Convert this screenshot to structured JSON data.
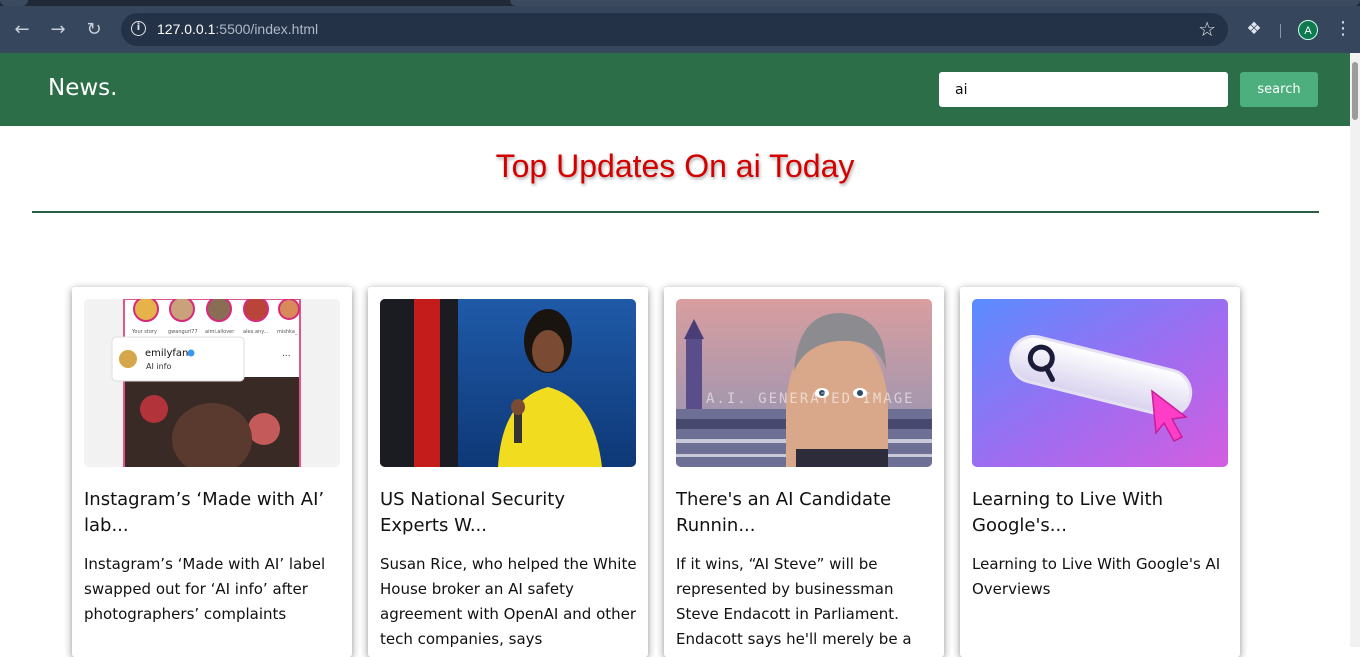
{
  "browser": {
    "url_host": "127.0.0.1",
    "url_rest": ":5500/index.html",
    "profile_initial": "A"
  },
  "header": {
    "brand": "News.",
    "search_value": "ai",
    "search_button": "search"
  },
  "page": {
    "heading": "Top Updates On ai Today"
  },
  "cards": [
    {
      "title": "Instagram’s ‘Made with AI’ lab...",
      "description": "Instagram’s ‘Made with AI’ label swapped out for ‘AI info’ after photographers’ complaints",
      "thumb_caption": "emilyfan",
      "thumb_sub": "AI info",
      "thumb_names": [
        "Your story",
        "gwangurl77",
        "aimi.allover",
        "alex.any...",
        "mishka_"
      ]
    },
    {
      "title": "US National Security Experts W...",
      "description": "Susan Rice, who helped the White House broker an AI safety agreement with OpenAI and other tech companies, says"
    },
    {
      "title": "There's an AI Candidate Runnin...",
      "description": "If it wins, “AI Steve” will be represented by businessman Steve Endacott in Parliament. Endacott says he'll merely be a",
      "thumb_watermark": "A.I. GENERATED IMAGE"
    },
    {
      "title": "Learning to Live With Google's...",
      "description": "Learning to Live With Google's AI Overviews"
    }
  ],
  "icons": {
    "back": "arrow-left-icon",
    "forward": "arrow-right-icon",
    "reload": "reload-icon",
    "info": "info-icon",
    "bookmark": "star-icon",
    "extensions": "puzzle-icon",
    "menu": "kebab-menu-icon"
  },
  "colors": {
    "navbar": "#2b6e47",
    "search_button": "#4caf7d",
    "heading": "#d40000",
    "rule": "#2b5e42"
  }
}
